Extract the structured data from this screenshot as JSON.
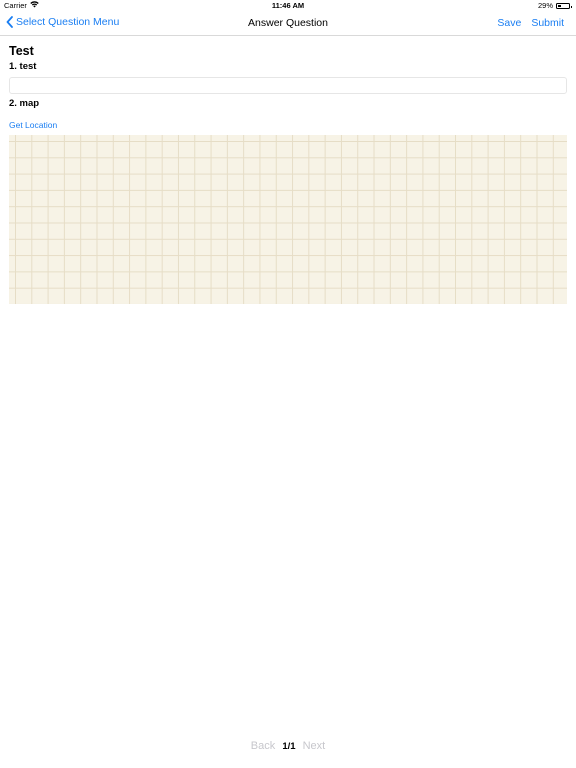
{
  "status_bar": {
    "carrier": "Carrier",
    "time": "11:46 AM",
    "battery_percent": "29%",
    "battery_level": 0.29,
    "wifi_icon": "wifi-icon",
    "battery_icon": "battery-icon"
  },
  "nav": {
    "back_label": "Select Question Menu",
    "back_icon": "chevron-left-icon",
    "title": "Answer Question",
    "save_label": "Save",
    "submit_label": "Submit"
  },
  "content": {
    "survey_title": "Test",
    "questions": [
      {
        "label": "1. test",
        "answer_value": "",
        "answer_placeholder": ""
      },
      {
        "label": "2. map"
      }
    ],
    "get_location_label": "Get Location"
  },
  "pagination": {
    "back_label": "Back",
    "page_indicator": "1/1",
    "next_label": "Next"
  },
  "colors": {
    "accent": "#1a7ef2",
    "disabled": "#c7c7cc",
    "map_background": "#f7f3e6",
    "map_grid": "#e6ddc6"
  }
}
